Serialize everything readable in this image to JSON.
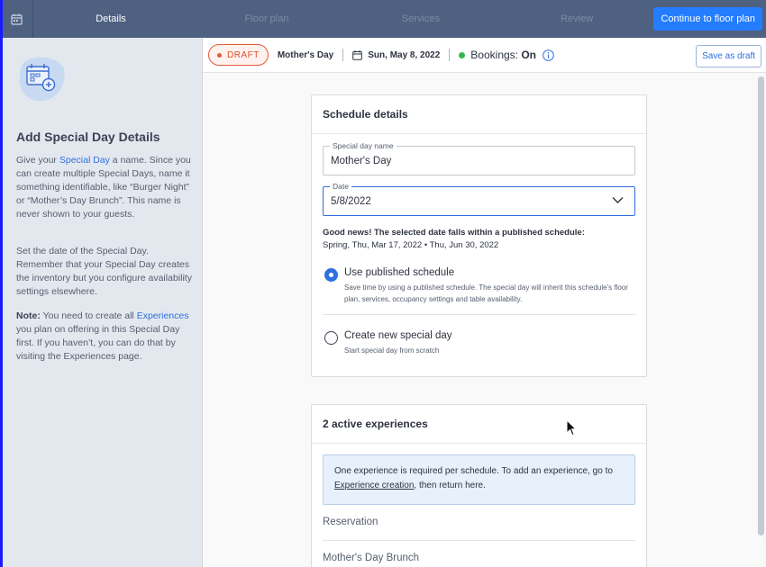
{
  "topbar": {
    "steps": [
      "Details",
      "Floor plan",
      "Services",
      "Review"
    ],
    "continue_label": "Continue to floor plan"
  },
  "sidebar": {
    "title": "Add Special Day Details",
    "p1_a": "Give your ",
    "p1_link": "Special Day",
    "p1_b": " a name. Since you can create multiple Special Days, name it something identifiable, like “Burger Night” or “Mother’s Day Brunch”. This name is never shown to your guests.",
    "p2": "Set the date of the Special Day. Remember that your Special Day creates the inventory but you configure availability settings elsewhere.",
    "p3_note": "Note:",
    "p3_a": " You need to create all ",
    "p3_link": "Experiences",
    "p3_b": " you plan on offering in this Special Day first. If you haven’t, you can do that by visiting the Experiences page."
  },
  "subheader": {
    "badge": "DRAFT",
    "name": "Mother's Day",
    "date": "Sun, May 8, 2022",
    "bookings_label": "Bookings:",
    "bookings_value": "On",
    "save_label": "Save as draft"
  },
  "schedule": {
    "title": "Schedule details",
    "name_label": "Special day name",
    "name_value": "Mother's Day",
    "date_label": "Date",
    "date_value": "5/8/2022",
    "goodnews_title": "Good news! The selected date falls within a published schedule:",
    "goodnews_range": "Spring, Thu, Mar 17, 2022 • Thu, Jun 30, 2022",
    "options": [
      {
        "label": "Use published schedule",
        "desc": "Save time by using a published schedule. The special day will inherit this schedule's floor plan, services, occupancy settings and table availability.",
        "selected": true
      },
      {
        "label": "Create new special day",
        "desc": "Start special day from scratch",
        "selected": false
      }
    ]
  },
  "experiences": {
    "title": "2 active experiences",
    "notice_a": "One experience is required per schedule. To add an experience, go to ",
    "notice_link": "Experience creation",
    "notice_b": ", then return here.",
    "items": [
      "Reservation",
      "Mother's Day Brunch"
    ]
  },
  "colors": {
    "topbar": "#4f6180",
    "primary": "#247cff",
    "draft": "#e25a3d",
    "sidebar": "#e3e8ef",
    "bookings_on": "#32b84b"
  }
}
